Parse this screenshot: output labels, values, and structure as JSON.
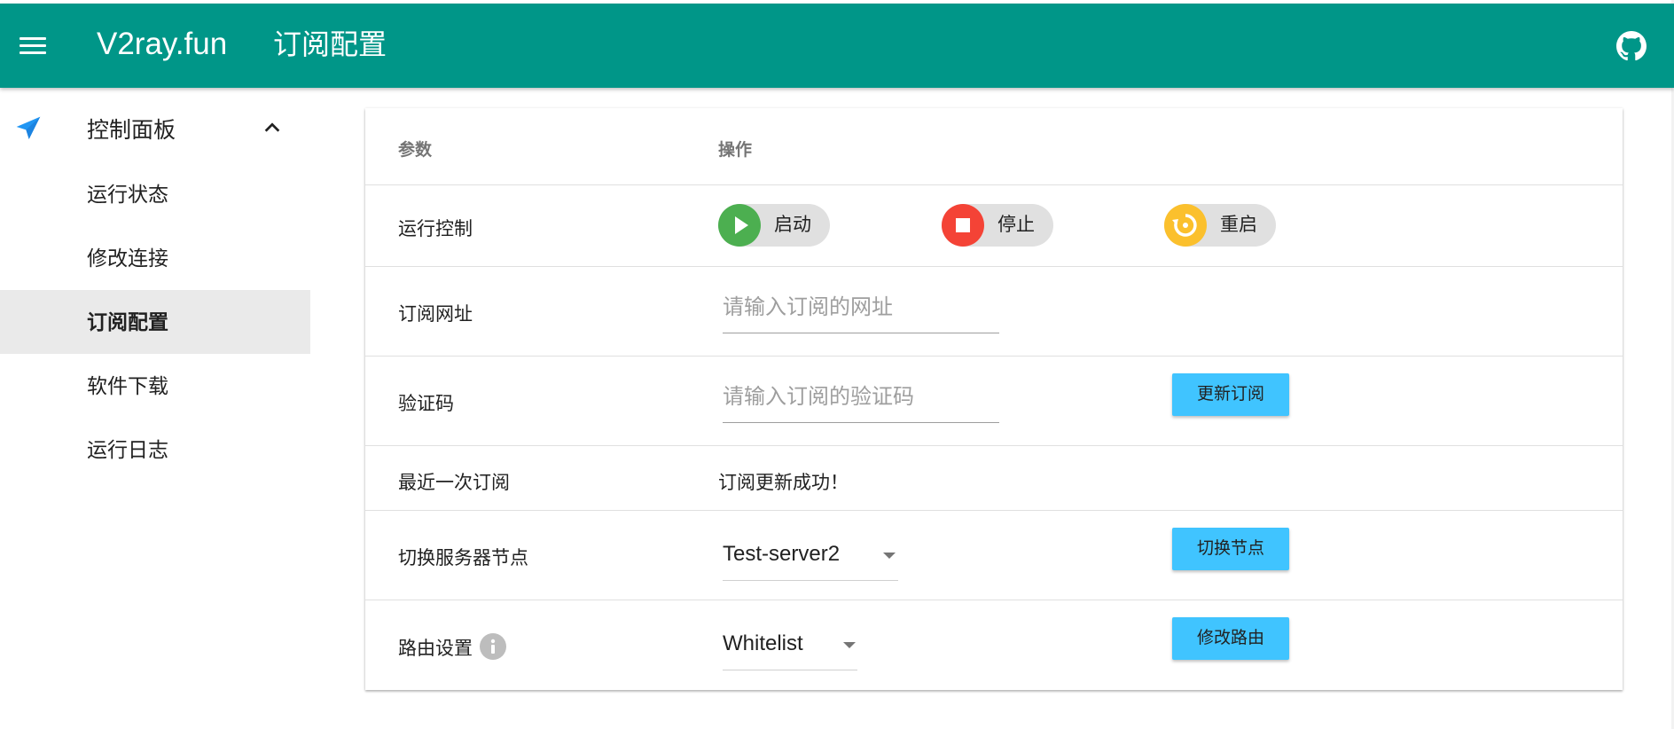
{
  "appbar": {
    "brand": "V2ray.fun",
    "title": "订阅配置",
    "color": "#009688"
  },
  "sidebar": {
    "parent": {
      "label": "控制面板",
      "icon": "send-icon",
      "expanded": true
    },
    "items": [
      {
        "label": "运行状态",
        "active": false
      },
      {
        "label": "修改连接",
        "active": false
      },
      {
        "label": "订阅配置",
        "active": true
      },
      {
        "label": "软件下载",
        "active": false
      },
      {
        "label": "运行日志",
        "active": false
      }
    ]
  },
  "table": {
    "headers": {
      "param": "参数",
      "action": "操作"
    },
    "run_control": {
      "label": "运行控制",
      "start": {
        "label": "启动",
        "color": "#4caf50"
      },
      "stop": {
        "label": "停止",
        "color": "#f44336"
      },
      "restart": {
        "label": "重启",
        "color": "#fbc02d"
      }
    },
    "sub_url": {
      "label": "订阅网址",
      "placeholder": "请输入订阅的网址",
      "value": ""
    },
    "captcha": {
      "label": "验证码",
      "placeholder": "请输入订阅的验证码",
      "value": "",
      "button": "更新订阅"
    },
    "last_sub": {
      "label": "最近一次订阅",
      "value": "订阅更新成功！"
    },
    "server": {
      "label": "切换服务器节点",
      "selected": "Test-server2",
      "button": "切换节点"
    },
    "route": {
      "label": "路由设置",
      "selected": "Whitelist",
      "button": "修改路由"
    }
  },
  "accent": "#40c4ff"
}
